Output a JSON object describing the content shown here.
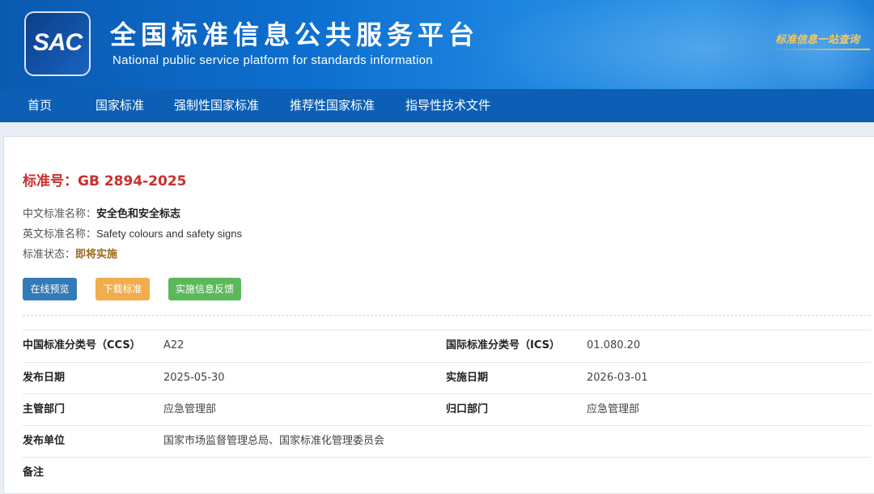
{
  "header": {
    "logo_text": "SAC",
    "title": "全国标准信息公共服务平台",
    "subtitle": "National public service platform  for standards information",
    "slogan": "标准信息一站查询"
  },
  "nav": {
    "items": [
      "首页",
      "国家标准",
      "强制性国家标准",
      "推荐性国家标准",
      "指导性技术文件"
    ]
  },
  "standard": {
    "number_label": "标准号：",
    "number": "GB 2894-2025",
    "cn_name_label": "中文标准名称：",
    "cn_name": "安全色和安全标志",
    "en_name_label": "英文标准名称：",
    "en_name": "Safety colours and safety signs",
    "status_label": "标准状态：",
    "status": "即将实施"
  },
  "buttons": {
    "preview": "在线预览",
    "download": "下载标准",
    "feedback": "实施信息反馈"
  },
  "colors": {
    "nav_bg": "#0c5fb5",
    "accent_red": "#c9302c",
    "btn_blue": "#337ab7",
    "btn_orange": "#f0ad4e",
    "btn_green": "#5cb85c"
  },
  "details": {
    "ccs_label": "中国标准分类号（CCS）",
    "ccs": "A22",
    "ics_label": "国际标准分类号（ICS）",
    "ics": "01.080.20",
    "pub_date_label": "发布日期",
    "pub_date": "2025-05-30",
    "impl_date_label": "实施日期",
    "impl_date": "2026-03-01",
    "dept_label": "主管部门",
    "dept": "应急管理部",
    "owner_label": "归口部门",
    "owner": "应急管理部",
    "publisher_label": "发布单位",
    "publisher": "国家市场监督管理总局、国家标准化管理委员会",
    "remark_label": "备注",
    "remark": ""
  }
}
